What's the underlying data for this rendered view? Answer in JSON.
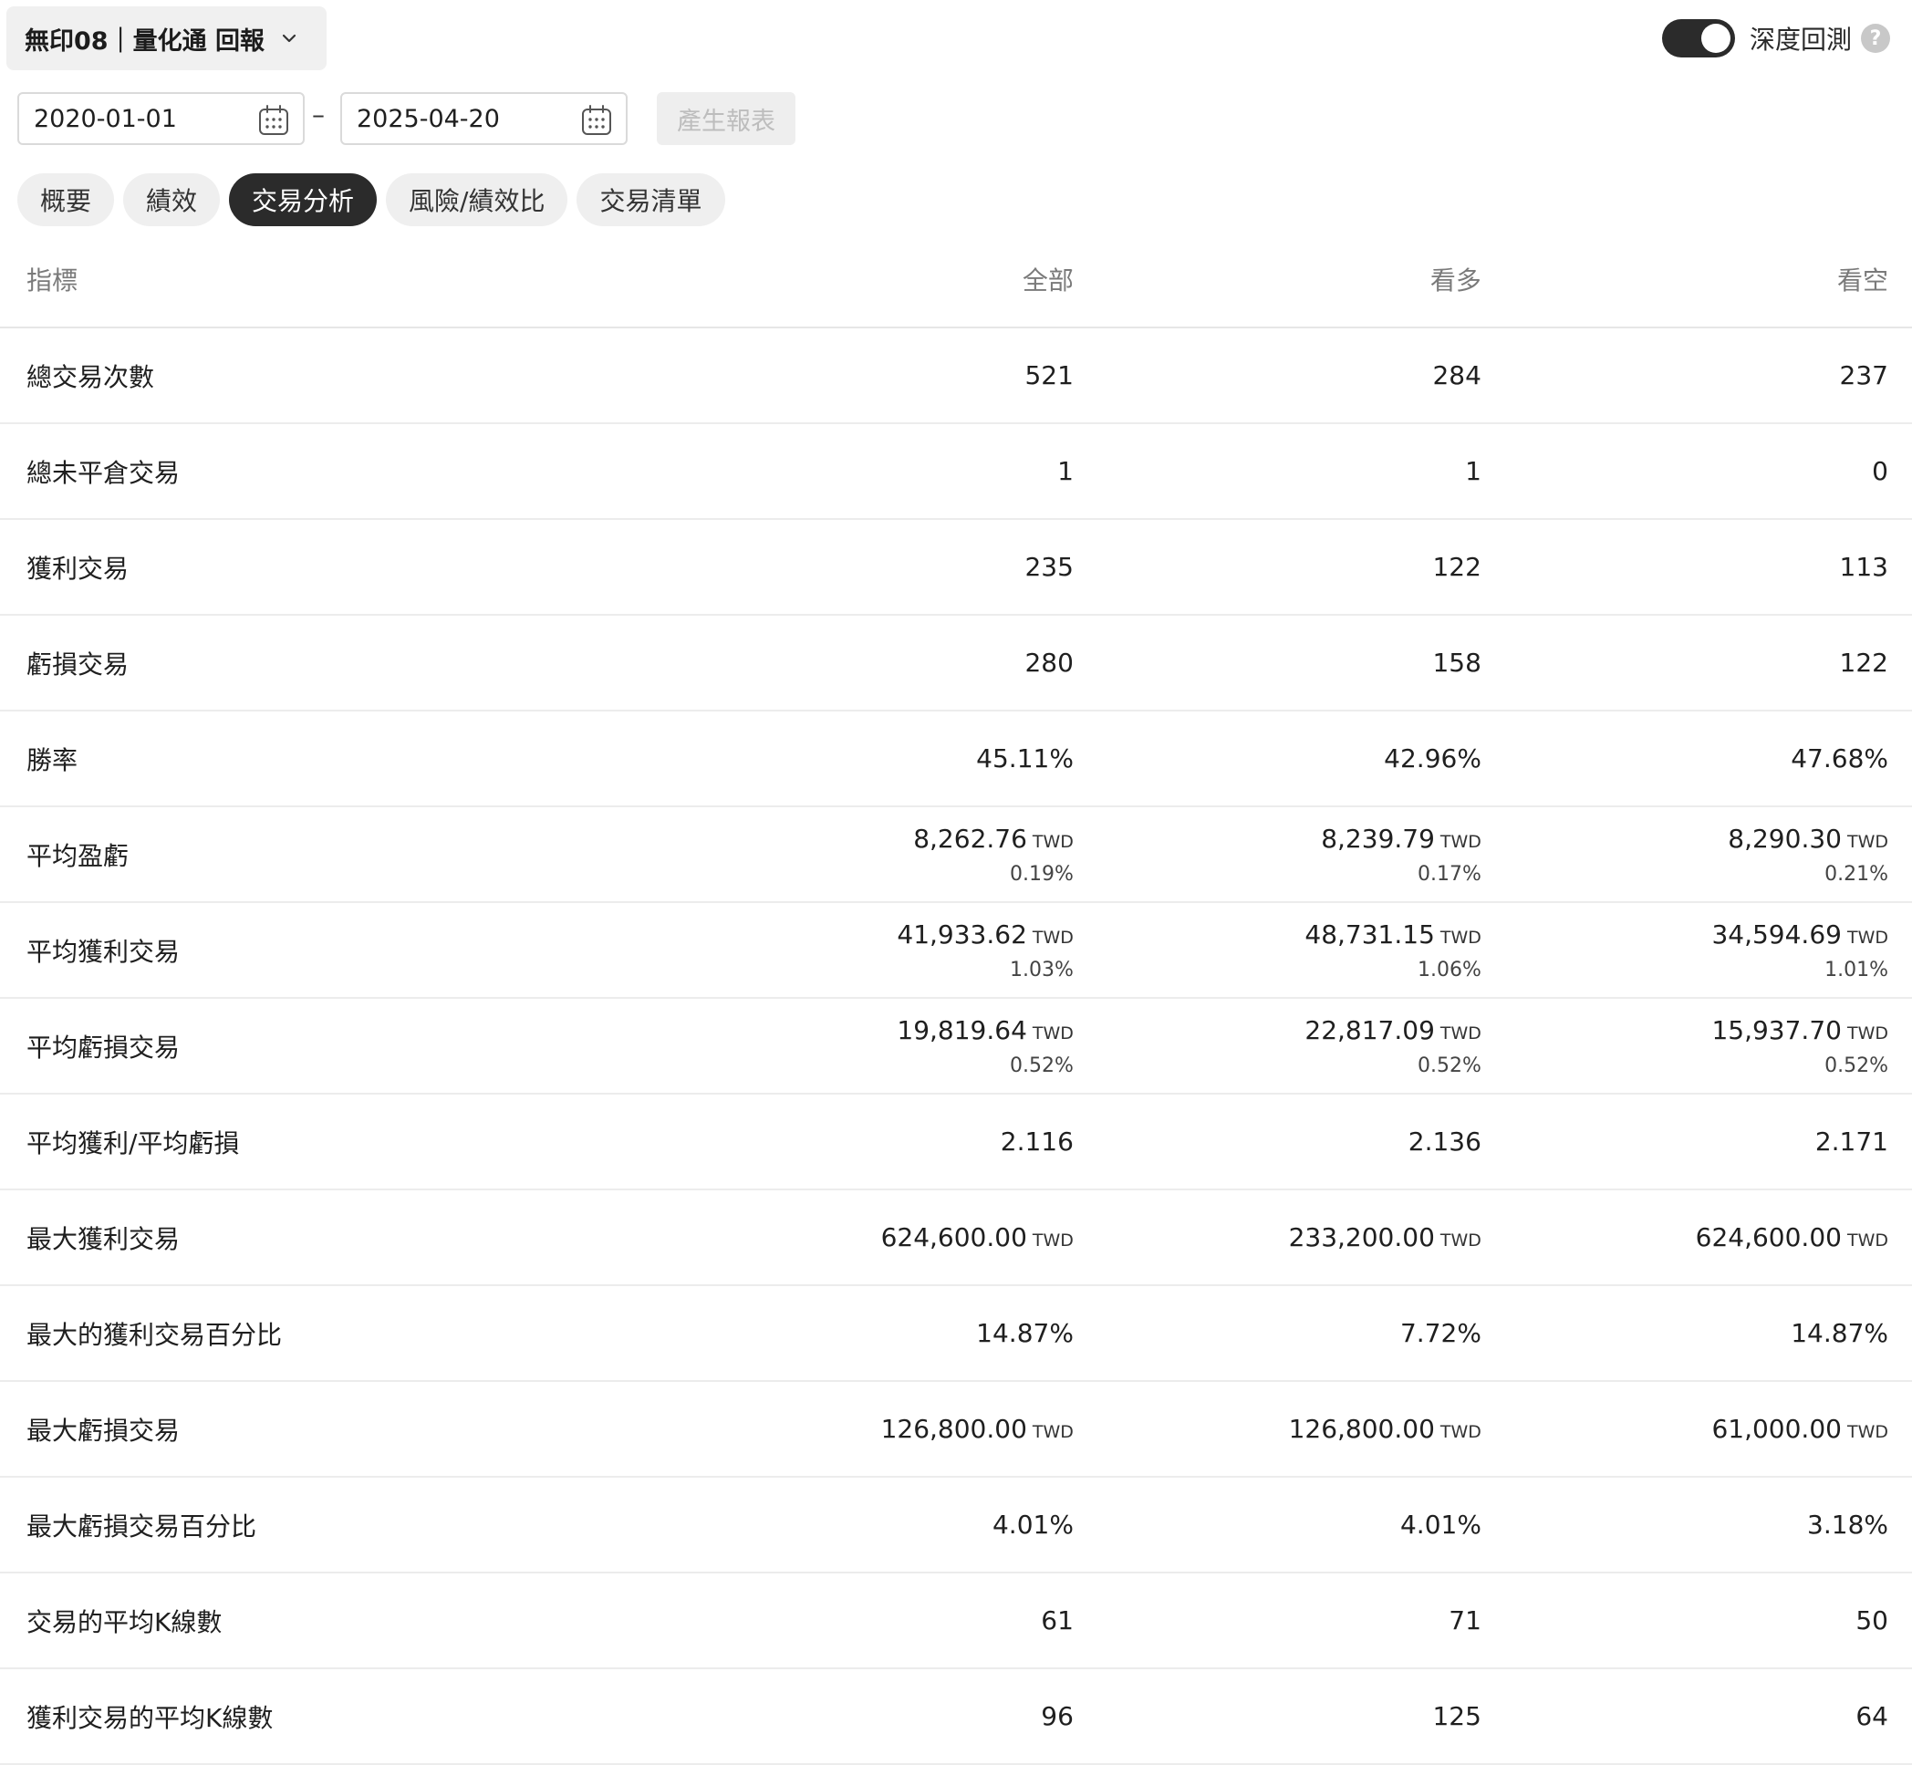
{
  "header": {
    "strategy_label": "無印08｜量化通 回報",
    "deep_backtest_label": "深度回測",
    "deep_backtest_on": true,
    "help_label": "?"
  },
  "date_range": {
    "start": "2020-01-01",
    "end": "2025-04-20",
    "separator": "–",
    "generate_label": "產生報表"
  },
  "tabs": [
    {
      "label": "概要",
      "active": false
    },
    {
      "label": "績效",
      "active": false
    },
    {
      "label": "交易分析",
      "active": true
    },
    {
      "label": "風險/績效比",
      "active": false
    },
    {
      "label": "交易清單",
      "active": false
    }
  ],
  "table": {
    "headers": {
      "name": "指標",
      "all": "全部",
      "long": "看多",
      "short": "看空"
    },
    "unit": "TWD",
    "rows": [
      {
        "name": "總交易次數",
        "all": {
          "v": "521"
        },
        "long": {
          "v": "284"
        },
        "short": {
          "v": "237"
        }
      },
      {
        "name": "總未平倉交易",
        "all": {
          "v": "1"
        },
        "long": {
          "v": "1"
        },
        "short": {
          "v": "0"
        }
      },
      {
        "name": "獲利交易",
        "all": {
          "v": "235"
        },
        "long": {
          "v": "122"
        },
        "short": {
          "v": "113"
        }
      },
      {
        "name": "虧損交易",
        "all": {
          "v": "280"
        },
        "long": {
          "v": "158"
        },
        "short": {
          "v": "122"
        }
      },
      {
        "name": "勝率",
        "all": {
          "v": "45.11%"
        },
        "long": {
          "v": "42.96%"
        },
        "short": {
          "v": "47.68%"
        }
      },
      {
        "name": "平均盈虧",
        "all": {
          "v": "8,262.76",
          "u": "TWD",
          "s": "0.19%"
        },
        "long": {
          "v": "8,239.79",
          "u": "TWD",
          "s": "0.17%"
        },
        "short": {
          "v": "8,290.30",
          "u": "TWD",
          "s": "0.21%"
        }
      },
      {
        "name": "平均獲利交易",
        "all": {
          "v": "41,933.62",
          "u": "TWD",
          "s": "1.03%"
        },
        "long": {
          "v": "48,731.15",
          "u": "TWD",
          "s": "1.06%"
        },
        "short": {
          "v": "34,594.69",
          "u": "TWD",
          "s": "1.01%"
        }
      },
      {
        "name": "平均虧損交易",
        "all": {
          "v": "19,819.64",
          "u": "TWD",
          "s": "0.52%"
        },
        "long": {
          "v": "22,817.09",
          "u": "TWD",
          "s": "0.52%"
        },
        "short": {
          "v": "15,937.70",
          "u": "TWD",
          "s": "0.52%"
        }
      },
      {
        "name": "平均獲利/平均虧損",
        "all": {
          "v": "2.116"
        },
        "long": {
          "v": "2.136"
        },
        "short": {
          "v": "2.171"
        }
      },
      {
        "name": "最大獲利交易",
        "all": {
          "v": "624,600.00",
          "u": "TWD"
        },
        "long": {
          "v": "233,200.00",
          "u": "TWD"
        },
        "short": {
          "v": "624,600.00",
          "u": "TWD"
        }
      },
      {
        "name": "最大的獲利交易百分比",
        "all": {
          "v": "14.87%"
        },
        "long": {
          "v": "7.72%"
        },
        "short": {
          "v": "14.87%"
        }
      },
      {
        "name": "最大虧損交易",
        "all": {
          "v": "126,800.00",
          "u": "TWD"
        },
        "long": {
          "v": "126,800.00",
          "u": "TWD"
        },
        "short": {
          "v": "61,000.00",
          "u": "TWD"
        }
      },
      {
        "name": "最大虧損交易百分比",
        "all": {
          "v": "4.01%"
        },
        "long": {
          "v": "4.01%"
        },
        "short": {
          "v": "3.18%"
        }
      },
      {
        "name": "交易的平均K線數",
        "all": {
          "v": "61"
        },
        "long": {
          "v": "71"
        },
        "short": {
          "v": "50"
        }
      },
      {
        "name": "獲利交易的平均K線數",
        "all": {
          "v": "96"
        },
        "long": {
          "v": "125"
        },
        "short": {
          "v": "64"
        }
      }
    ]
  },
  "colors": {
    "accent_dark": "#2b2b2b",
    "tab_bg": "#efefef",
    "border": "#e6e6e6",
    "muted_text": "#7a7a7a"
  },
  "icons": {
    "dropdown": "chevron-down-icon",
    "calendar": "calendar-icon",
    "help": "help-icon"
  }
}
